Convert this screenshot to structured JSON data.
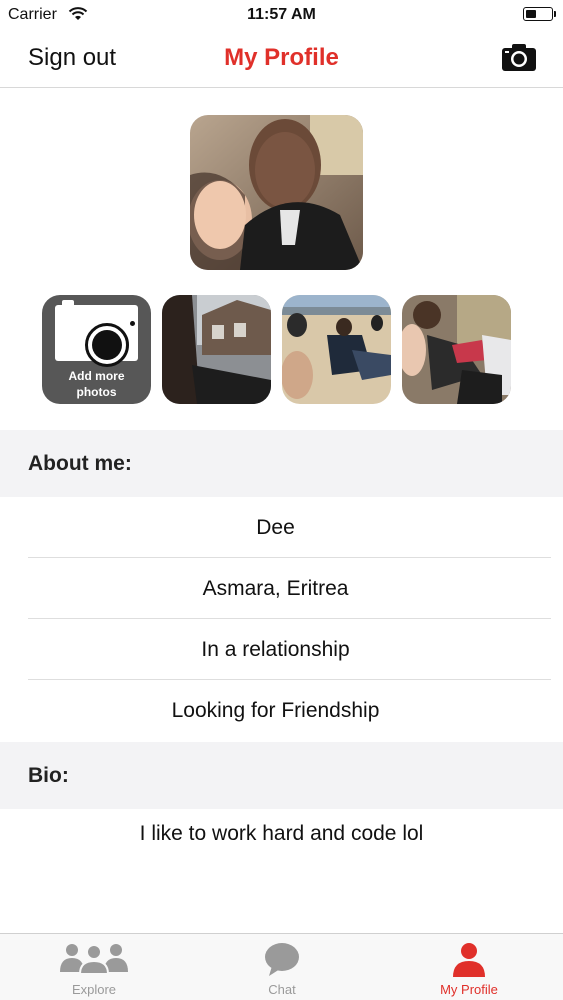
{
  "status_bar": {
    "carrier": "Carrier",
    "time": "11:57 AM",
    "battery_level": 0.4
  },
  "nav": {
    "left_label": "Sign out",
    "title": "My Profile",
    "right_icon": "camera-icon"
  },
  "photos": {
    "main_alt": "profile-photo",
    "add_label": "Add more\nphotos",
    "thumbnails": [
      "photo-1",
      "photo-2",
      "photo-3"
    ]
  },
  "about": {
    "header": "About me:",
    "rows": [
      "Dee",
      "Asmara, Eritrea",
      "In a relationship",
      "Looking for Friendship"
    ]
  },
  "bio": {
    "header": "Bio:",
    "text": "I like to work hard and code lol"
  },
  "tabs": [
    {
      "label": "Explore",
      "icon": "people-icon",
      "active": false
    },
    {
      "label": "Chat",
      "icon": "chat-bubble-icon",
      "active": false
    },
    {
      "label": "My Profile",
      "icon": "person-icon",
      "active": true
    }
  ],
  "colors": {
    "accent": "#e0302a",
    "inactive": "#9a9a9a",
    "section_bg": "#f3f3f5"
  }
}
